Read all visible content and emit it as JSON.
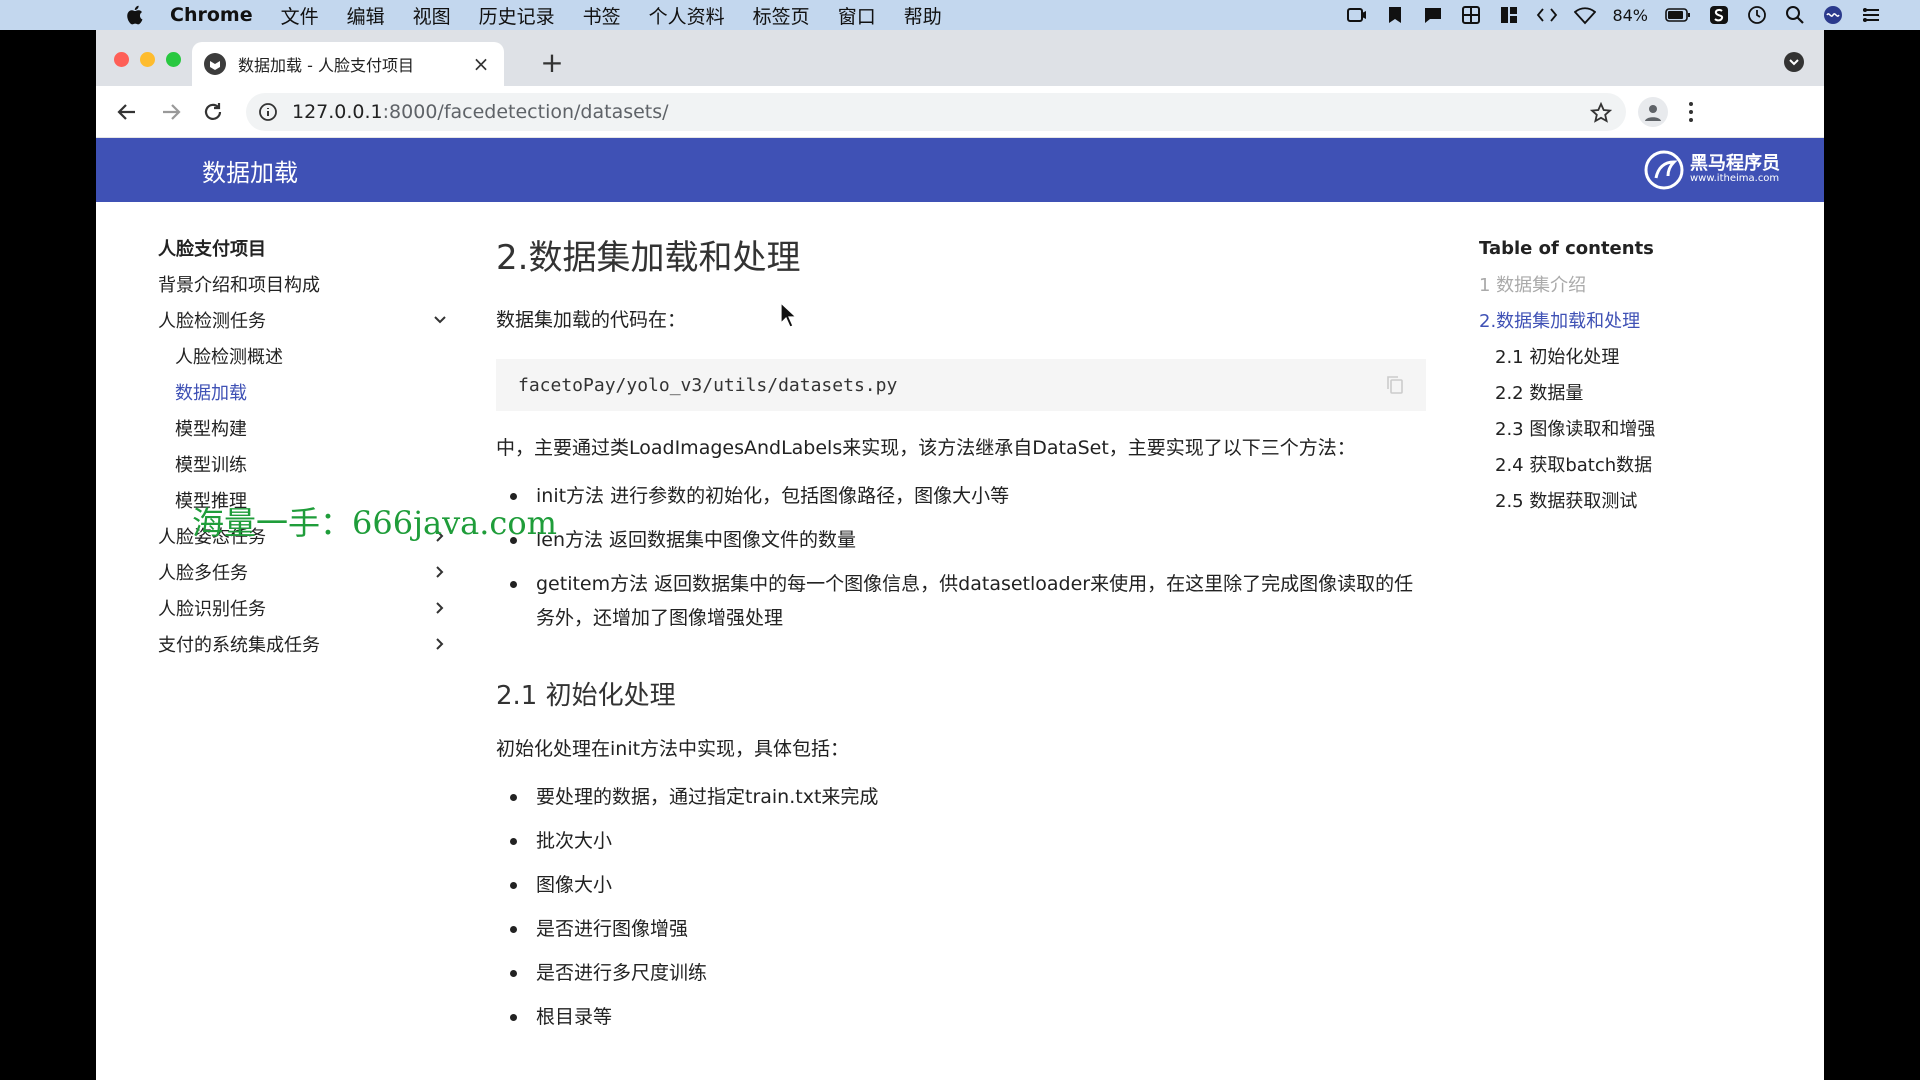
{
  "menubar": {
    "app": "Chrome",
    "items": [
      "文件",
      "编辑",
      "视图",
      "历史记录",
      "书签",
      "个人资料",
      "标签页",
      "窗口",
      "帮助"
    ],
    "battery": "84%"
  },
  "browser": {
    "tab_title": "数据加载 - 人脸支付项目",
    "tab_close": "×",
    "new_tab": "+",
    "url_host": "127.0.0.1",
    "url_path": ":8000/facedetection/datasets/"
  },
  "header": {
    "title": "数据加载",
    "logo_cn": "黑马程序员",
    "logo_en": "www.itheima.com"
  },
  "nav": {
    "project": "人脸支付项目",
    "items": [
      {
        "label": "背景介绍和项目构成"
      },
      {
        "label": "人脸检测任务"
      },
      {
        "label": "人脸检测概述"
      },
      {
        "label": "数据加载"
      },
      {
        "label": "模型构建"
      },
      {
        "label": "模型训练"
      },
      {
        "label": "模型推理"
      },
      {
        "label": "人脸姿态任务"
      },
      {
        "label": "人脸多任务"
      },
      {
        "label": "人脸识别任务"
      },
      {
        "label": "支付的系统集成任务"
      }
    ]
  },
  "main": {
    "h1": "2.数据集加载和处理",
    "p_code_intro": "数据集加载的代码在：",
    "code": "facetoPay/yolo_v3/utils/datasets.py",
    "p_desc": "中，主要通过类LoadImagesAndLabels来实现，该方法继承自DataSet，主要实现了以下三个方法：",
    "bullets1": [
      "init方法 进行参数的初始化，包括图像路径，图像大小等",
      "len方法 返回数据集中图像文件的数量",
      "getitem方法 返回数据集中的每一个图像信息，供datasetloader来使用，在这里除了完成图像读取的任务外，还增加了图像增强处理"
    ],
    "h2": "2.1 初始化处理",
    "p_init": "初始化处理在init方法中实现，具体包括：",
    "bullets2": [
      "要处理的数据，通过指定train.txt来完成",
      "批次大小",
      "图像大小",
      "是否进行图像增强",
      "是否进行多尺度训练",
      "根目录等"
    ]
  },
  "toc": {
    "head": "Table of contents",
    "items": [
      {
        "label": "1 数据集介绍"
      },
      {
        "label": "2.数据集加载和处理"
      },
      {
        "label": "2.1 初始化处理"
      },
      {
        "label": "2.2 数据量"
      },
      {
        "label": "2.3 图像读取和增强"
      },
      {
        "label": "2.4 获取batch数据"
      },
      {
        "label": "2.5 数据获取测试"
      }
    ]
  },
  "watermark": "海量一手：666java.com",
  "colors": {
    "header": "#3f51b5",
    "active": "#3f51b5",
    "menubar": "#c3d7ee",
    "tabstrip": "#dee1e6"
  }
}
